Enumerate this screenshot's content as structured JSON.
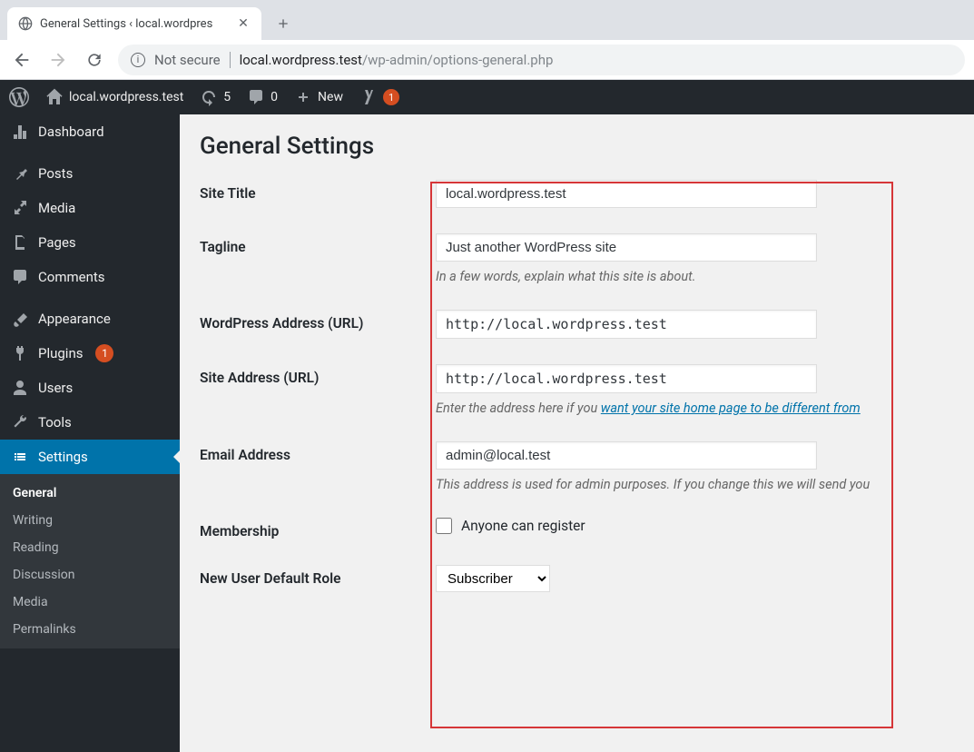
{
  "browser": {
    "tab_title": "General Settings ‹ local.wordpres",
    "not_secure": "Not secure",
    "url_host": "local.wordpress.test",
    "url_path": "/wp-admin/options-general.php"
  },
  "adminbar": {
    "site_name": "local.wordpress.test",
    "updates_count": "5",
    "comments_count": "0",
    "new_label": "New",
    "yoast_badge": "1"
  },
  "sidebar": {
    "dashboard": "Dashboard",
    "posts": "Posts",
    "media": "Media",
    "pages": "Pages",
    "comments": "Comments",
    "appearance": "Appearance",
    "plugins": "Plugins",
    "plugins_count": "1",
    "users": "Users",
    "tools": "Tools",
    "settings": "Settings",
    "submenu": {
      "general": "General",
      "writing": "Writing",
      "reading": "Reading",
      "discussion": "Discussion",
      "media": "Media",
      "permalinks": "Permalinks"
    }
  },
  "page": {
    "title": "General Settings",
    "labels": {
      "site_title": "Site Title",
      "tagline": "Tagline",
      "wp_address": "WordPress Address (URL)",
      "site_address": "Site Address (URL)",
      "email": "Email Address",
      "membership": "Membership",
      "default_role": "New User Default Role"
    },
    "values": {
      "site_title": "local.wordpress.test",
      "tagline": "Just another WordPress site",
      "wp_address": "http://local.wordpress.test",
      "site_address": "http://local.wordpress.test",
      "email": "admin@local.test",
      "default_role_selected": "Subscriber"
    },
    "descriptions": {
      "tagline": "In a few words, explain what this site is about.",
      "site_address_pre": "Enter the address here if you ",
      "site_address_link": "want your site home page to be different from ",
      "email": "This address is used for admin purposes. If you change this we will send you"
    },
    "membership_checkbox_label": "Anyone can register"
  }
}
